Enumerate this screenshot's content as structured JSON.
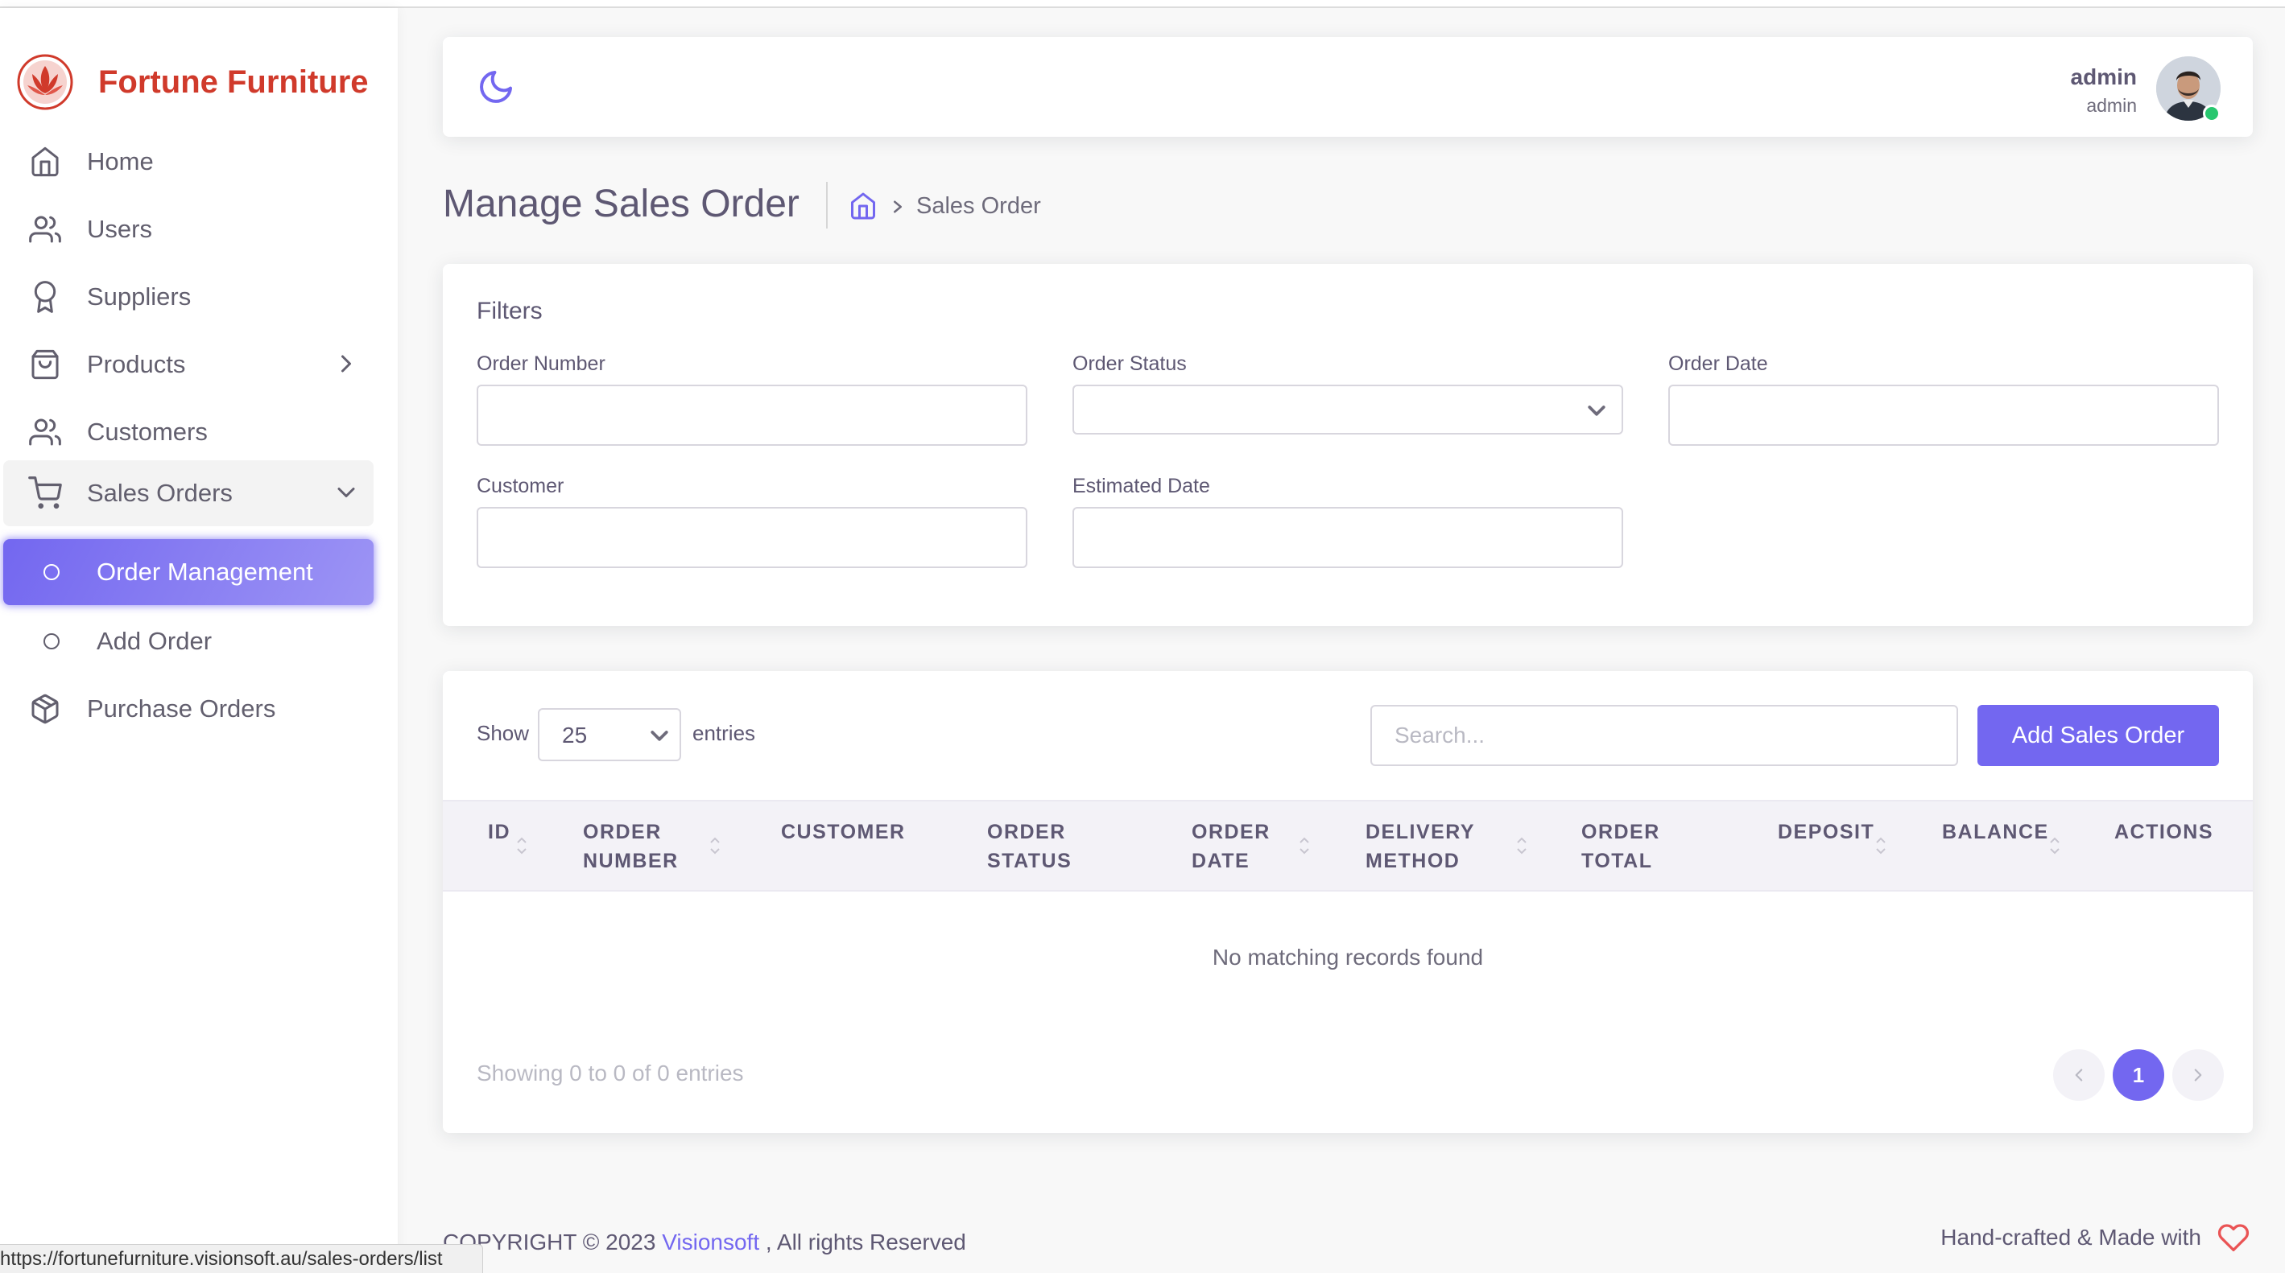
{
  "brand": {
    "name": "Fortune Furniture",
    "logo_icon": "lotus-logo-icon",
    "color": "#d03a2b"
  },
  "accent_color": "#7367f0",
  "sidebar": {
    "items": [
      {
        "label": "Home",
        "icon": "home-icon"
      },
      {
        "label": "Users",
        "icon": "users-icon"
      },
      {
        "label": "Suppliers",
        "icon": "award-icon"
      },
      {
        "label": "Products",
        "icon": "shopping-bag-icon",
        "has_submenu": true
      },
      {
        "label": "Customers",
        "icon": "users-icon"
      },
      {
        "label": "Sales Orders",
        "icon": "shopping-cart-icon",
        "expanded": true
      },
      {
        "label": "Order Management",
        "icon": "circle-icon",
        "active": true
      },
      {
        "label": "Add Order",
        "icon": "circle-icon"
      },
      {
        "label": "Purchase Orders",
        "icon": "package-icon"
      }
    ]
  },
  "header": {
    "theme_toggle_icon": "moon-icon",
    "user": {
      "name": "admin",
      "role": "admin",
      "status": "online"
    }
  },
  "page": {
    "title": "Manage Sales Order",
    "breadcrumb": {
      "home_icon": "home-icon",
      "current": "Sales Order"
    }
  },
  "filters": {
    "title": "Filters",
    "order_number": {
      "label": "Order Number",
      "value": ""
    },
    "order_status": {
      "label": "Order Status",
      "value": ""
    },
    "order_date": {
      "label": "Order Date",
      "value": ""
    },
    "customer": {
      "label": "Customer",
      "value": ""
    },
    "estimated_date": {
      "label": "Estimated Date",
      "value": ""
    }
  },
  "table": {
    "show_label": "Show",
    "entries_value": "25",
    "entries_label": "entries",
    "search_placeholder": "Search...",
    "add_button": "Add Sales Order",
    "columns": [
      {
        "line1": "ID",
        "line2": "",
        "sortable": true
      },
      {
        "line1": "ORDER",
        "line2": "NUMBER",
        "sortable": true
      },
      {
        "line1": "CUSTOMER",
        "line2": "",
        "sortable": false
      },
      {
        "line1": "ORDER",
        "line2": "STATUS",
        "sortable": false
      },
      {
        "line1": "ORDER",
        "line2": "DATE",
        "sortable": true
      },
      {
        "line1": "DELIVERY",
        "line2": "METHOD",
        "sortable": true
      },
      {
        "line1": "ORDER",
        "line2": "TOTAL",
        "sortable": false
      },
      {
        "line1": "DEPOSIT",
        "line2": "",
        "sortable": true
      },
      {
        "line1": "BALANCE",
        "line2": "",
        "sortable": true
      },
      {
        "line1": "ACTIONS",
        "line2": "",
        "sortable": false
      }
    ],
    "rows": [],
    "empty_message": "No matching records found",
    "info": "Showing 0 to 0 of 0 entries",
    "pagination": {
      "current_page": "1"
    }
  },
  "footer": {
    "copyright_prefix": "COPYRIGHT © 2023",
    "company": "Visionsoft",
    "copyright_suffix": ", All rights Reserved",
    "made_with": "Hand-crafted & Made with",
    "heart_icon": "heart-icon"
  },
  "browser_status_url": "https://fortunefurniture.visionsoft.au/sales-orders/list"
}
